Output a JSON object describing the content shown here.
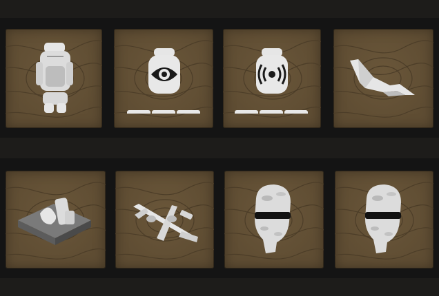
{
  "inventory": {
    "rows": [
      {
        "slots": [
          {
            "item_icon": "tactical-backpack-icon",
            "charges": 0,
            "charges_total": 0
          },
          {
            "item_icon": "uav-recon-eye-icon",
            "charges": 0,
            "charges_total": 3
          },
          {
            "item_icon": "signal-jammer-icon",
            "charges": 0,
            "charges_total": 3
          },
          {
            "item_icon": "stealth-bomber-icon",
            "charges": 0,
            "charges_total": 0
          }
        ]
      },
      {
        "slots": [
          {
            "item_icon": "supply-crate-icon",
            "charges": 0,
            "charges_total": 0
          },
          {
            "item_icon": "gunship-aircraft-icon",
            "charges": 0,
            "charges_total": 0
          },
          {
            "item_icon": "camo-balaclava-icon",
            "charges": 0,
            "charges_total": 0
          },
          {
            "item_icon": "camo-balaclava-icon",
            "charges": 0,
            "charges_total": 0
          }
        ]
      }
    ]
  },
  "colors": {
    "background": "#141414",
    "slot_fill": "#5f4d33",
    "topo_line": "#4c3d28",
    "icon_light": "#e6e6e6",
    "icon_shade": "#9a9a9a"
  }
}
